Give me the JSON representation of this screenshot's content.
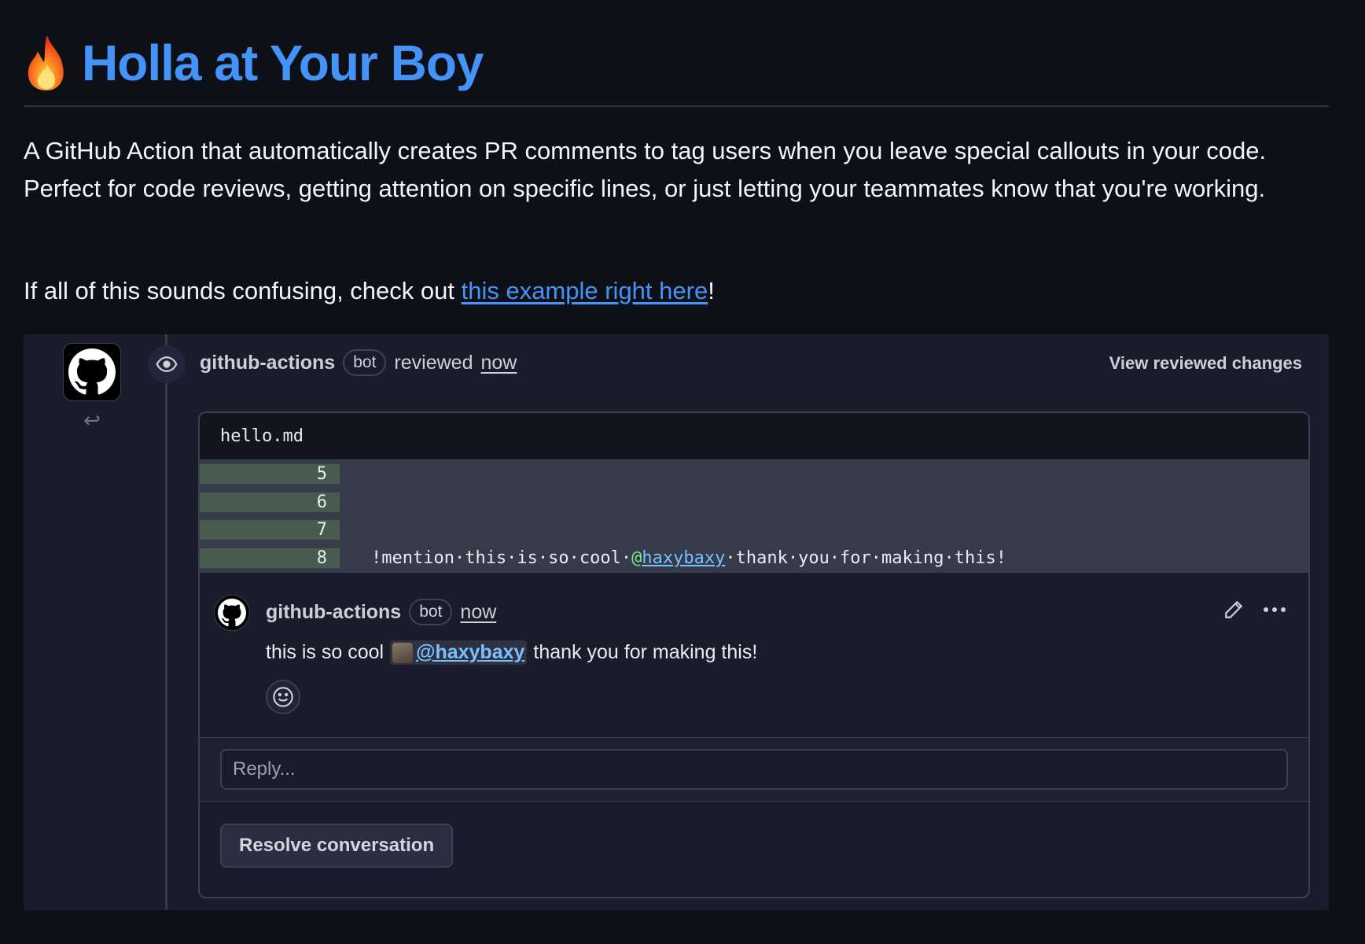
{
  "header": {
    "title": "Holla at Your Boy"
  },
  "intro": {
    "paragraph": "A GitHub Action that automatically creates PR comments to tag users when you leave special callouts in your code. Perfect for code reviews, getting attention on specific lines, or just letting your teammates know that you're working.",
    "example_prefix": "If all of this sounds confusing, check out ",
    "example_link": "this example right here",
    "example_suffix": "!"
  },
  "review": {
    "author": "github-actions",
    "bot_label": "bot",
    "action": "reviewed",
    "time": "now",
    "view_changes": "View reviewed changes",
    "file": "hello.md",
    "diff_lines": [
      {
        "num": "5",
        "code": ""
      },
      {
        "num": "6",
        "code": ""
      },
      {
        "num": "7",
        "code": ""
      },
      {
        "num": "8",
        "code_prefix": "!mention·this·is·so·cool·",
        "mention_at": "@",
        "mention_name": "haxybaxy",
        "code_suffix": "·thank·you·for·making·this!"
      }
    ],
    "comment": {
      "author": "github-actions",
      "bot_label": "bot",
      "time": "now",
      "body_prefix": "this is so cool",
      "mention": "@haxybaxy",
      "body_suffix": "thank you for making this!"
    },
    "reply_placeholder": "Reply...",
    "resolve_label": "Resolve conversation"
  },
  "colors": {
    "page_bg": "#0d1117",
    "panel_bg": "#1b1c2b",
    "link": "#4493f8",
    "diff_added_gutter": "#495b4f"
  }
}
